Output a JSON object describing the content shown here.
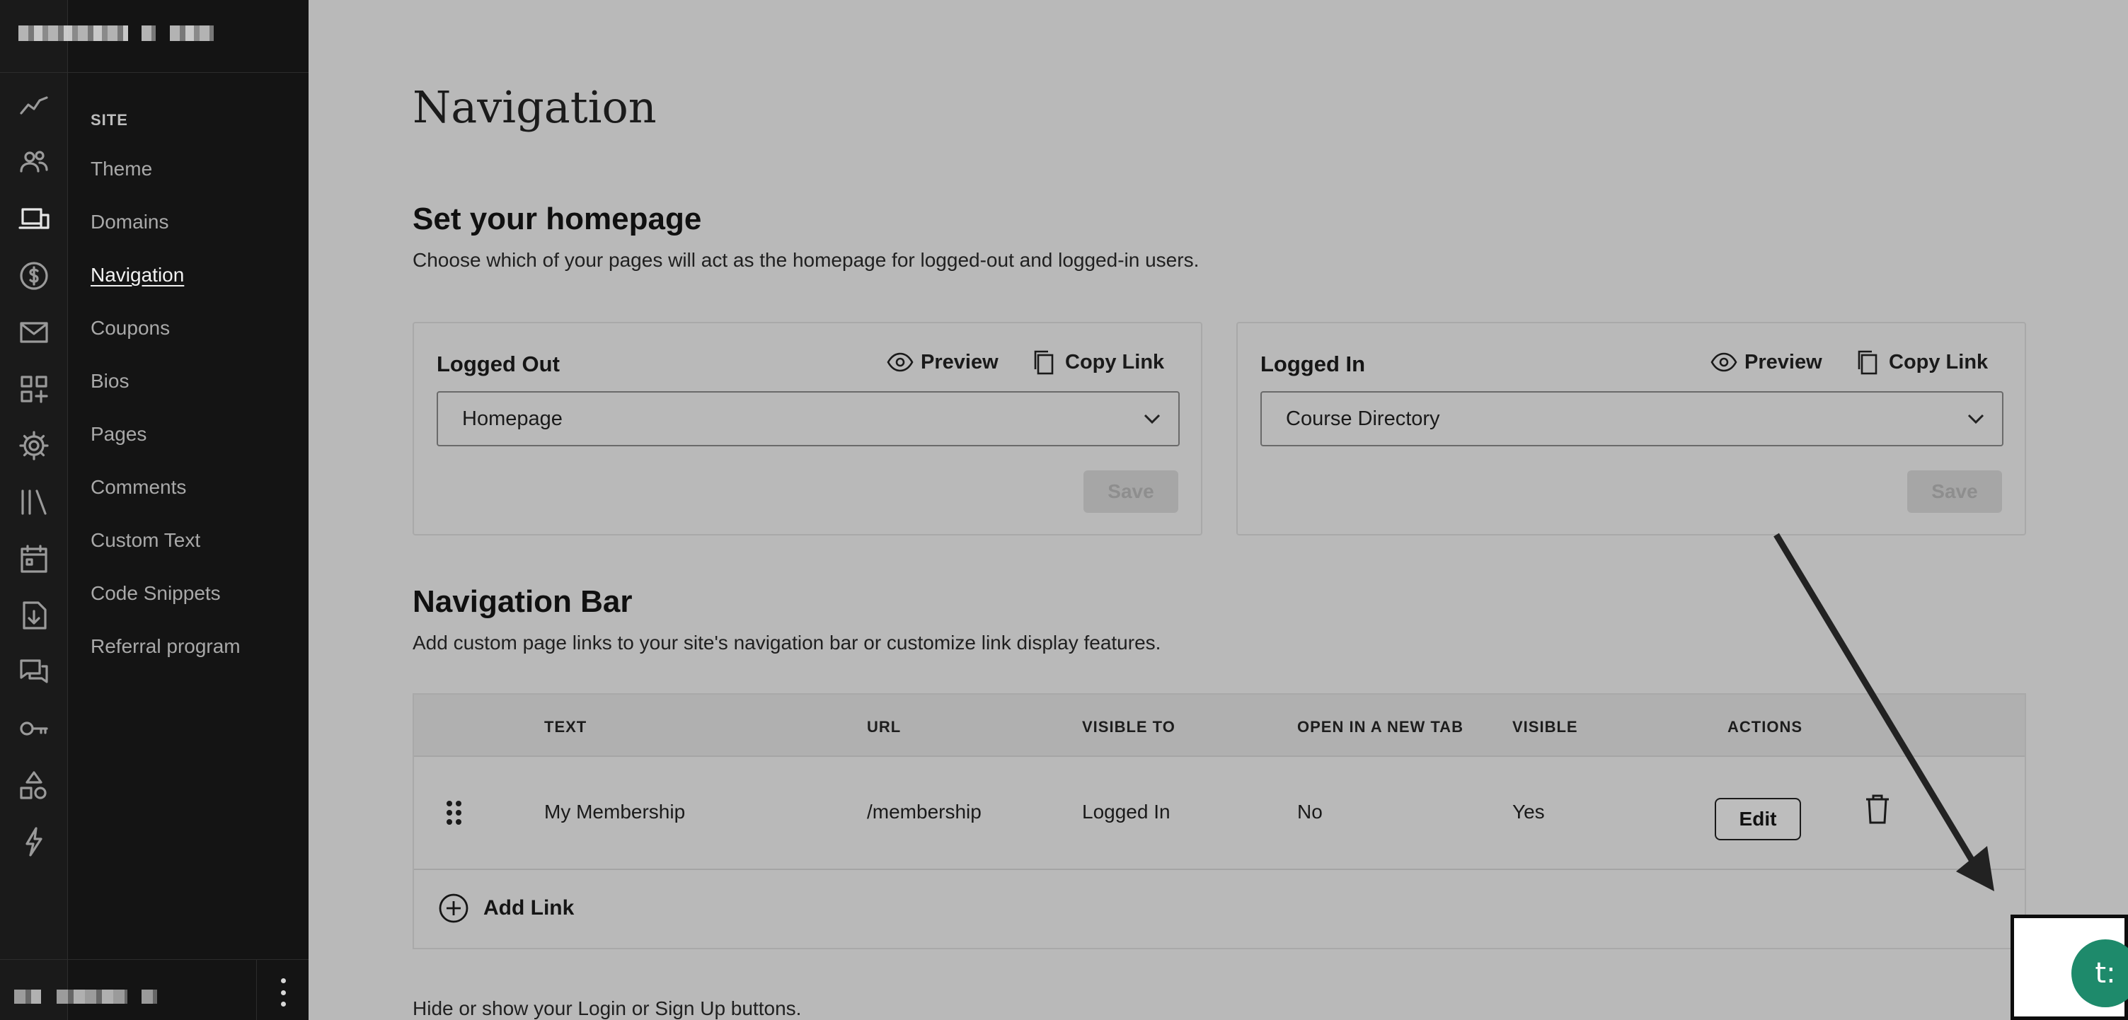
{
  "sidebar": {
    "section_label": "SITE",
    "items": [
      {
        "label": "Theme",
        "active": false
      },
      {
        "label": "Domains",
        "active": false
      },
      {
        "label": "Navigation",
        "active": true
      },
      {
        "label": "Coupons",
        "active": false
      },
      {
        "label": "Bios",
        "active": false
      },
      {
        "label": "Pages",
        "active": false
      },
      {
        "label": "Comments",
        "active": false
      },
      {
        "label": "Custom Text",
        "active": false
      },
      {
        "label": "Code Snippets",
        "active": false
      },
      {
        "label": "Referral program",
        "active": false
      }
    ],
    "rail_icons": [
      "analytics-icon",
      "users-icon",
      "devices-icon",
      "dollar-icon",
      "mail-icon",
      "apps-add-icon",
      "gear-icon",
      "library-icon",
      "calendar-icon",
      "download-file-icon",
      "chat-icon",
      "key-icon",
      "shapes-icon",
      "lightning-icon"
    ]
  },
  "main": {
    "title": "Navigation",
    "homepage": {
      "heading": "Set your homepage",
      "description": "Choose which of your pages will act as the homepage for logged-out and logged-in users.",
      "cards": [
        {
          "label": "Logged Out",
          "preview": "Preview",
          "copy": "Copy Link",
          "selected": "Homepage",
          "save": "Save"
        },
        {
          "label": "Logged In",
          "preview": "Preview",
          "copy": "Copy Link",
          "selected": "Course Directory",
          "save": "Save"
        }
      ]
    },
    "navbar": {
      "heading": "Navigation Bar",
      "description": "Add custom page links to your site's navigation bar or customize link display features.",
      "columns": [
        "TEXT",
        "URL",
        "VISIBLE TO",
        "OPEN IN A NEW TAB",
        "VISIBLE",
        "ACTIONS"
      ],
      "rows": [
        {
          "text": "My Membership",
          "url": "/membership",
          "visible_to": "Logged In",
          "new_tab": "No",
          "visible": "Yes",
          "edit": "Edit"
        }
      ],
      "add_link": "Add Link"
    },
    "bottom_text": "Hide or show your Login or Sign Up buttons."
  },
  "chat": {
    "label": "t:",
    "color": "#1e8a6b"
  }
}
